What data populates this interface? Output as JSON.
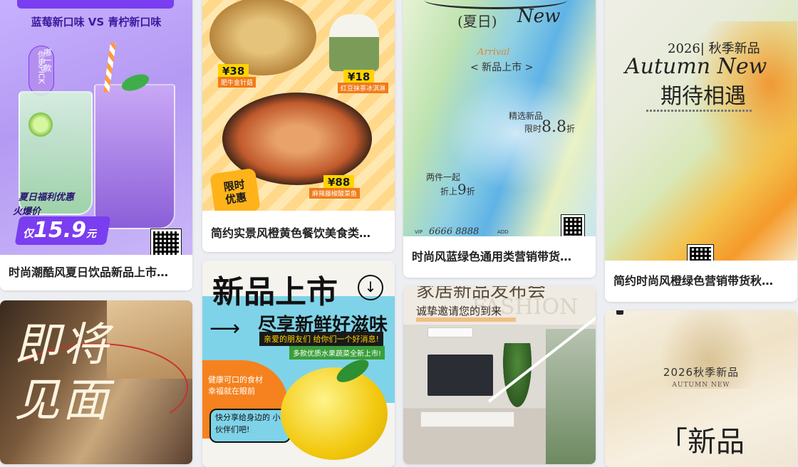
{
  "cards": [
    {
      "caption": "时尚潮酷风夏日饮品新品上市…",
      "subtitle": "蓝莓新口味 VS 青柠新口味",
      "pick_text": "你更PICK",
      "which_text": "哪一款",
      "promo_title": "夏日福利优惠",
      "promo_label": "火爆价",
      "price_prefix": "仅",
      "price": "15.9",
      "price_unit": "元"
    },
    {
      "caption": "简约实景风橙黄色餐饮美食类…",
      "items": [
        {
          "price": "¥38",
          "name": "肥牛金针菇"
        },
        {
          "price": "¥18",
          "name": "红豆抹茶冰淇淋"
        },
        {
          "price": "¥88",
          "name": "麻辣藤椒酸菜鱼"
        }
      ],
      "limited_label": "限时优惠"
    },
    {
      "caption": "时尚风蓝绿色通用类营销带货…",
      "title_cn": "(夏日)",
      "title_en": "New",
      "arrival": "Arrival",
      "new_product": "< 新品上市 >",
      "selected": "精选新品",
      "limited_discount": "限时",
      "discount_value": "8.8",
      "discount_unit": "折",
      "two_items": "两件一起",
      "two_discount_prefix": "折上",
      "two_discount_value": "9",
      "two_discount_unit": "折",
      "vip_label": "VIP",
      "vip_number": "6666 8888",
      "add_label": "ADD"
    },
    {
      "caption": "简约时尚风橙绿色营销带货秋…",
      "year_line": "2026| 秋季新品",
      "autumn_en": "Autumn New",
      "tagline": "期待相遇"
    },
    {
      "calligraphy": "即将见面"
    },
    {
      "headline": "新品上市",
      "sub_headline": "尽享新鲜好滋味",
      "ribbon1": "亲爱的朋友们 给你们一个好消息!",
      "ribbon2": "多款优质水果蔬菜全新上市!",
      "note1": "健康可口的食材 幸福就在眼前",
      "note2": "快分享给身边的 小伙伴们吧!"
    },
    {
      "title": "家居新品发布会",
      "invite": "诚挚邀请您的到来",
      "watermark": "FASHION"
    },
    {
      "year_line": "2026秋季新品",
      "autumn_en": "AUTUMN NEW",
      "big_text": "「新品"
    }
  ],
  "colors": {
    "purple": "#b89af0",
    "orange": "#f7a23b",
    "teal": "#7fd3e8",
    "cream": "#efe6d5"
  }
}
